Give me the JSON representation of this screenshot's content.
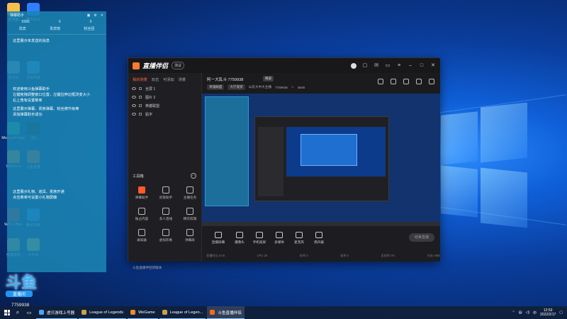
{
  "desktop": {
    "icons": [
      {
        "label": "此电脑",
        "color": "#f5c04a"
      },
      {
        "label": "腾讯会议",
        "color": "#2f7fff"
      },
      {
        "label": "回收站",
        "color": "#8aa6c4"
      },
      {
        "label": "百度网盘",
        "color": "#3ba1ff"
      },
      {
        "label": "Microsoft Edge",
        "color": "#2bb673"
      },
      {
        "label": "QQ",
        "color": "#111111"
      },
      {
        "label": "WeGame",
        "color": "#f08a24"
      },
      {
        "label": "斗鱼直播",
        "color": "#ff6a1a"
      },
      {
        "label": "WPS Office",
        "color": "#c62828"
      },
      {
        "label": "腾讯视频",
        "color": "#2a8cff"
      },
      {
        "label": "英雄联盟",
        "color": "#c8a24a"
      },
      {
        "label": "文件夹",
        "color": "#f5c04a"
      }
    ]
  },
  "chat_panel": {
    "title": "弹幕助手",
    "stats": [
      "5966",
      "0",
      "0"
    ],
    "stats2": [
      "贵宾",
      "贵宾榜",
      "粉丝团"
    ],
    "messages": [
      "这里展示未发送的消息",
      "欢迎使用斗鱼弹幕助手",
      "左键拖拽调整窗口位置，左键拉伸边框改变大小",
      "右上角有设置菜单",
      "这里展示弹幕、贵族弹幕、粉丝牌升级等",
      "添加弹幕助手成功",
      "这里展示礼物、道具、贵族开通",
      "点击菜单可设置小礼物屏蔽"
    ]
  },
  "app": {
    "title": "直播伴侣",
    "version": "测试",
    "scene_tabs": [
      "我的场景",
      "双击",
      "可添加",
      "场景"
    ],
    "sources": [
      "全屏 1",
      "图片 2",
      "英雄联盟",
      "贴字"
    ],
    "tools_header": "工具箱",
    "tools": [
      {
        "label": "弹幕助手",
        "hot": true
      },
      {
        "label": "房管助手",
        "hot": false
      },
      {
        "label": "主播任务",
        "hot": false
      },
      {
        "label": "独占内容",
        "hot": false
      },
      {
        "label": "多人连线",
        "hot": false
      },
      {
        "label": "精华剪辑",
        "hot": false
      },
      {
        "label": "录屏器",
        "hot": false
      },
      {
        "label": "虚拟形象",
        "hot": false
      },
      {
        "label": "弹幕屏",
        "hot": false
      }
    ],
    "left_footer": "斗鱼直播伴侣新版本",
    "room": {
      "title": "阿一大乱斗 7759938",
      "badge": "换皮",
      "category": "英雄联盟",
      "subcategory": "大厅观赏",
      "extra": "山东大中大主播",
      "room_id": "7759938",
      "heat": "5606"
    },
    "bottom_tools": [
      "直播屏幕",
      "摄像头",
      "手机投屏",
      "多媒体",
      "麦克风",
      "扬声器"
    ],
    "go_live": "结束直播",
    "status": [
      "直播时长 0:00",
      "CPU 20",
      "码率 0",
      "帧率 0",
      "丢帧率 0%",
      "内存 0MB"
    ]
  },
  "overlay": {
    "logo_text": "斗鱼",
    "logo_sub": "直播间",
    "room_number": "7759938"
  },
  "taskbar": {
    "items": [
      {
        "label": "虚贝游戏上号器",
        "color": "#4aa3ff",
        "active": false
      },
      {
        "label": "League of Legends",
        "color": "#c8a24a",
        "active": false
      },
      {
        "label": "WeGame",
        "color": "#f08a24",
        "active": false
      },
      {
        "label": "League of Legen...",
        "color": "#c8a24a",
        "active": false
      },
      {
        "label": "斗鱼直播伴侣",
        "color": "#ff6a1a",
        "active": true
      }
    ],
    "time": "12:53",
    "date": "2022/2/17"
  }
}
